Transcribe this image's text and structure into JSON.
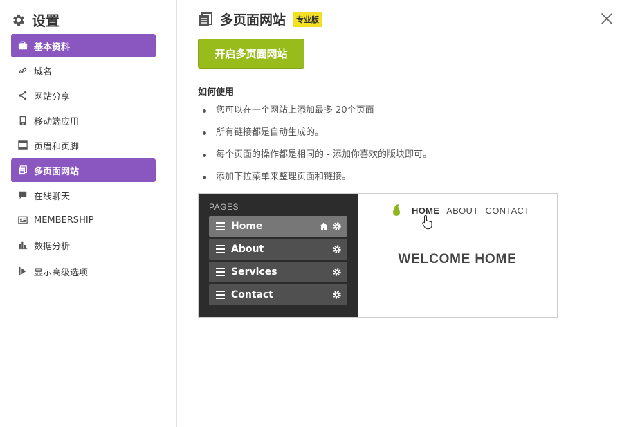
{
  "sidebar": {
    "title": "设置",
    "items": [
      {
        "label": "基本资料",
        "icon": "briefcase-icon",
        "active": true
      },
      {
        "label": "域名",
        "icon": "link-icon",
        "active": false
      },
      {
        "label": "网站分享",
        "icon": "share-icon",
        "active": false
      },
      {
        "label": "移动端应用",
        "icon": "mobile-icon",
        "active": false
      },
      {
        "label": "页眉和页脚",
        "icon": "header-footer-icon",
        "active": false
      },
      {
        "label": "多页面网站",
        "icon": "pages-icon",
        "active": true
      },
      {
        "label": "在线聊天",
        "icon": "chat-icon",
        "active": false
      },
      {
        "label": "MEMBERSHIP",
        "icon": "membership-icon",
        "active": false
      },
      {
        "label": "数据分析",
        "icon": "bar-chart-icon",
        "active": false
      }
    ],
    "advanced_label": "显示高级选项"
  },
  "main": {
    "title": "多页面网站",
    "badge": "专业版",
    "enable_button": "开启多页面网站",
    "howto_title": "如何使用",
    "bullets": [
      "您可以在一个网站上添加最多 20个页面",
      "所有链接都是自动生成的。",
      "每个页面的操作都是相同的 - 添加你喜欢的版块即可。",
      "添加下拉菜单来整理页面和链接。"
    ]
  },
  "preview": {
    "pages_label": "PAGES",
    "pages": [
      "Home",
      "About",
      "Services",
      "Contact"
    ],
    "site_nav": [
      "HOME",
      "ABOUT",
      "CONTACT"
    ],
    "welcome": "WELCOME HOME"
  },
  "colors": {
    "accent_purple": "#8a56c0",
    "button_green": "#98bc1c",
    "badge_yellow": "#f3e023",
    "logo_green": "#8db51f"
  }
}
